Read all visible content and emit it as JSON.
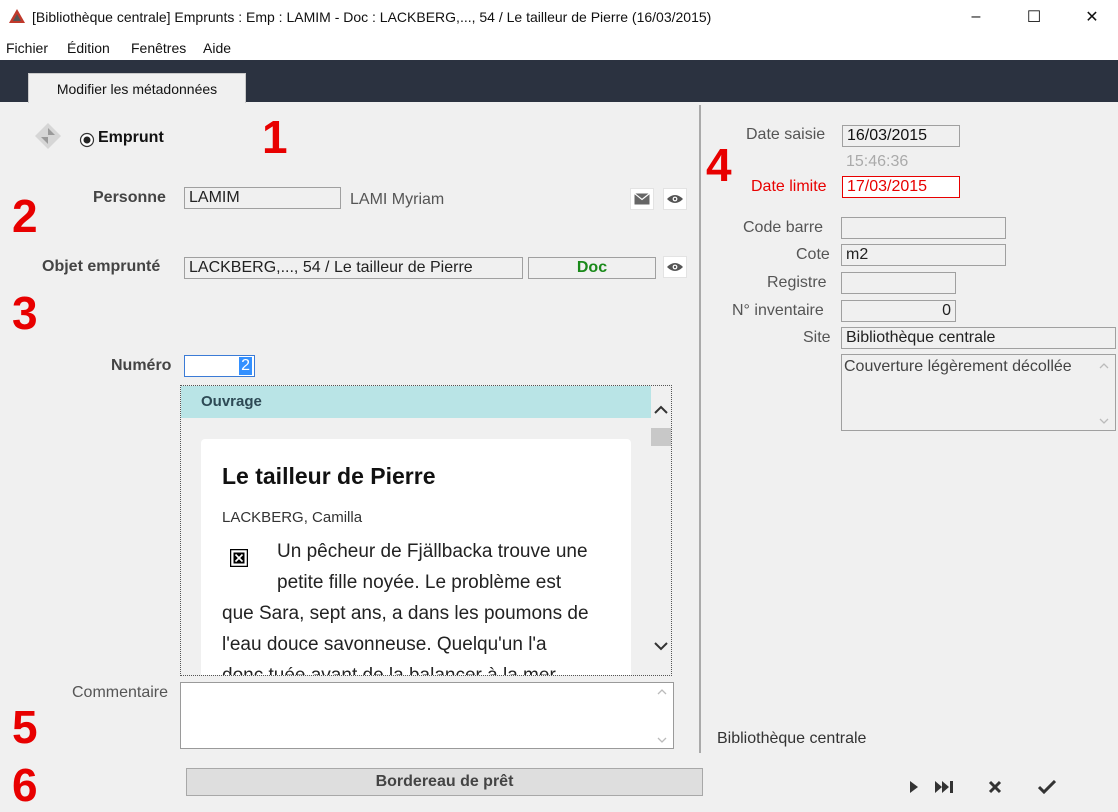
{
  "window": {
    "title": "[Bibliothèque centrale] Emprunts : Emp : LAMIM - Doc : LACKBERG,..., 54 / Le tailleur de Pierre (16/03/2015)",
    "minimize": "–",
    "maximize": "☐",
    "close": "✕"
  },
  "menu": [
    "Fichier",
    "Édition",
    "Fenêtres",
    "Aide"
  ],
  "tab": {
    "label": "Modifier les métadonnées"
  },
  "markers": [
    "1",
    "2",
    "3",
    "4",
    "5",
    "6"
  ],
  "emprunt": {
    "label": "Emprunt"
  },
  "personne": {
    "label": "Personne",
    "code": "LAMIM",
    "name": "LAMI Myriam"
  },
  "objet": {
    "label": "Objet emprunté",
    "value": "LACKBERG,..., 54 / Le tailleur de Pierre",
    "type": "Doc",
    "type_color": "#1a8a1a"
  },
  "numero": {
    "label": "Numéro",
    "value": "2"
  },
  "ouvrage": {
    "header": "Ouvrage",
    "title": "Le tailleur de Pierre",
    "author": "LACKBERG, Camilla",
    "summary_lines": [
      "Un pêcheur de Fjällbacka trouve une",
      "petite fille noyée. Le problème est",
      "que Sara, sept ans, a dans les poumons de",
      "l'eau douce savonneuse. Quelqu'un l'a",
      "donc tuée avant de la balancer à la mer."
    ]
  },
  "commentaire": {
    "label": "Commentaire",
    "value": ""
  },
  "bordereau": {
    "label": "Bordereau de prêt"
  },
  "right": {
    "date_saisie_label": "Date saisie",
    "date_saisie": "16/03/2015",
    "time": "15:46:36",
    "date_limite_label": "Date limite",
    "date_limite": "17/03/2015",
    "code_barre_label": "Code barre",
    "code_barre": "",
    "cote_label": "Cote",
    "cote": "m2",
    "registre_label": "Registre",
    "registre": "",
    "inventaire_label": "N° inventaire",
    "inventaire": "0",
    "site_label": "Site",
    "site": "Bibliothèque centrale",
    "note": "Couverture légèrement décollée",
    "footer": "Bibliothèque centrale"
  },
  "colors": {
    "accent_red": "#e80000",
    "header_dark": "#2b3240",
    "ouvrage_header": "#b9e4e6"
  }
}
